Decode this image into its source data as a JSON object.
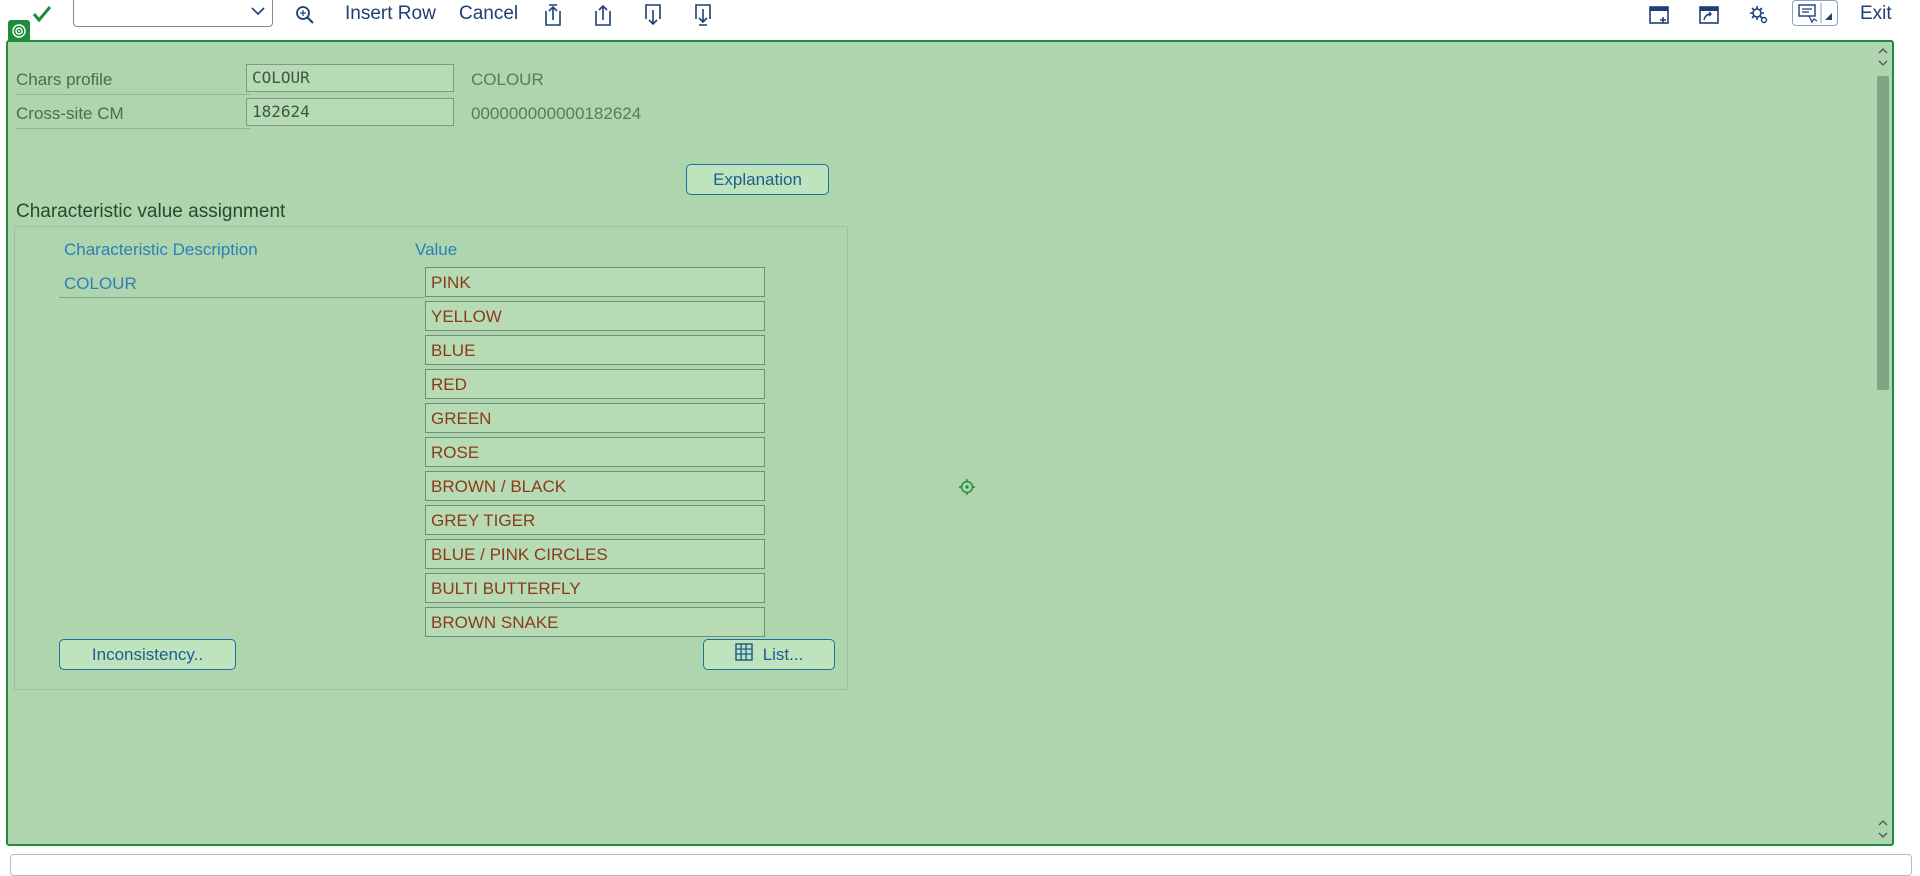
{
  "toolbar": {
    "command_value": "",
    "insert_row": "Insert Row",
    "cancel": "Cancel",
    "exit": "Exit",
    "icons": [
      "check-icon",
      "search-icon",
      "first-page-icon",
      "previous-page-icon",
      "next-page-icon",
      "last-page-icon",
      "new-window-icon",
      "shortcut-icon",
      "settings-icon",
      "customize-layout-icon"
    ]
  },
  "header": {
    "chars_profile_label": "Chars profile",
    "chars_profile_value": "COLOUR",
    "chars_profile_desc": "COLOUR",
    "cross_site_label": "Cross-site CM",
    "cross_site_value": "182624",
    "cross_site_desc": "000000000000182624"
  },
  "explanation_button": "Explanation",
  "section_title": "Characteristic value assignment",
  "table": {
    "col_description": "Characteristic Description",
    "col_value": "Value",
    "characteristic": "COLOUR",
    "values": [
      "PINK",
      "YELLOW",
      "BLUE",
      "RED",
      "GREEN",
      "ROSE",
      "BROWN / BLACK",
      "GREY TIGER",
      "BLUE / PINK CIRCLES",
      "BULTI BUTTERFLY",
      "BROWN SNAKE"
    ]
  },
  "buttons": {
    "inconsistency": "Inconsistency..",
    "list": "List..."
  },
  "colors": {
    "panel_background": "#aed5ad",
    "panel_border": "#1e8c3a",
    "value_text": "#8b3a1a",
    "column_header": "#2d7fb5"
  }
}
